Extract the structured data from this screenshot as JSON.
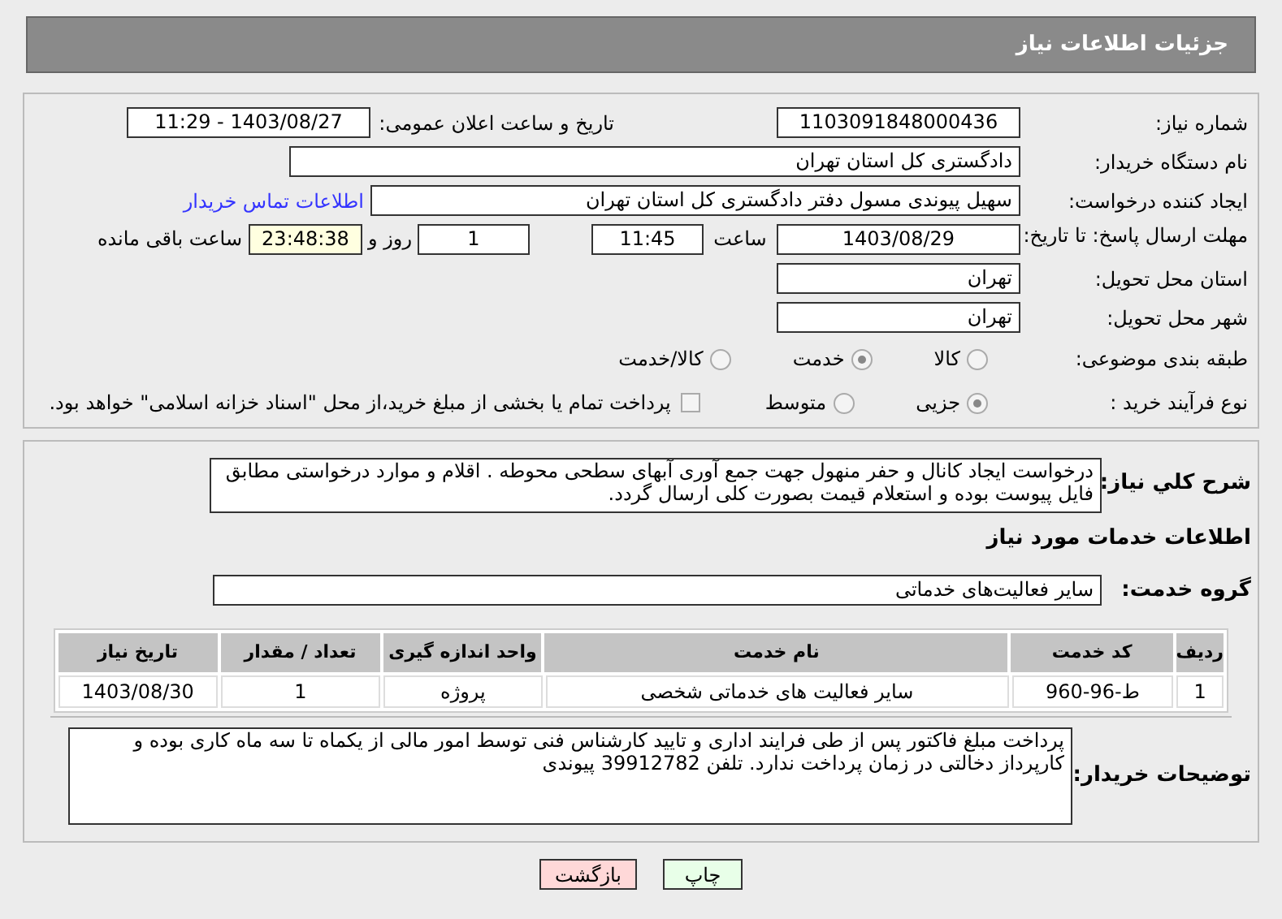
{
  "header": {
    "title": "جزئیات اطلاعات نیاز"
  },
  "need_number": {
    "label": "شماره نیاز:",
    "value": "1103091848000436"
  },
  "announce": {
    "label": "تاریخ و ساعت اعلان عمومی:",
    "value": "1403/08/27 - 11:29"
  },
  "buyer_org": {
    "label": "نام دستگاه خریدار:",
    "value": "دادگستری کل استان تهران"
  },
  "creator": {
    "label": "ایجاد کننده درخواست:",
    "value": "سهیل پیوندی مسول دفتر  دادگستری کل استان تهران",
    "link": "اطلاعات تماس خریدار"
  },
  "deadline": {
    "label": "مهلت ارسال پاسخ: تا تاریخ:",
    "date": "1403/08/29",
    "time_label": "ساعت",
    "time": "11:45",
    "days": "1",
    "days_label": "روز و",
    "remaining": "23:48:38",
    "remaining_label": "ساعت باقی مانده"
  },
  "province": {
    "label": "استان محل تحویل:",
    "value": "تهران"
  },
  "city": {
    "label": "شهر محل تحویل:",
    "value": "تهران"
  },
  "category": {
    "label": "طبقه بندی موضوعی:",
    "options": [
      {
        "label": "کالا",
        "selected": false
      },
      {
        "label": "خدمت",
        "selected": true
      },
      {
        "label": "کالا/خدمت",
        "selected": false
      }
    ]
  },
  "purchase_type": {
    "label": "نوع فرآیند خرید :",
    "options": [
      {
        "label": "جزیی",
        "selected": true
      },
      {
        "label": "متوسط",
        "selected": false
      }
    ],
    "treasury": {
      "label": "پرداخت تمام یا بخشی از مبلغ خرید،از محل \"اسناد خزانه اسلامی\" خواهد بود.",
      "checked": false
    }
  },
  "description": {
    "label": "شرح کلي نياز:",
    "value": "درخواست ایجاد کانال و حفر منهول جهت جمع آوری آبهای سطحی محوطه . اقلام و موارد درخواستی مطابق فایل پیوست بوده و استعلام قیمت بصورت کلی ارسال گردد."
  },
  "services_heading": "اطلاعات خدمات مورد نیاز",
  "service_group": {
    "label": "گروه خدمت:",
    "value": "سایر فعالیت‌های خدماتی"
  },
  "table": {
    "columns": [
      "ردیف",
      "کد خدمت",
      "نام خدمت",
      "واحد اندازه گیری",
      "تعداد / مقدار",
      "تاریخ نیاز"
    ],
    "rows": [
      [
        "1",
        "ط-96-960",
        "سایر فعالیت های خدماتی شخصی",
        "پروژه",
        "1",
        "1403/08/30"
      ]
    ]
  },
  "buyer_notes": {
    "label": "توضیحات خریدار:",
    "value": "پرداخت مبلغ فاکتور پس از طی فرایند اداری و تایید کارشناس فنی توسط امور مالی از یکماه تا سه ماه کاری بوده و کارپرداز دخالتی در زمان پرداخت ندارد. تلفن 39912782 پیوندی"
  },
  "buttons": [
    {
      "label": "چاپ",
      "kind": "print"
    },
    {
      "label": "بازگشت",
      "kind": "back"
    }
  ]
}
